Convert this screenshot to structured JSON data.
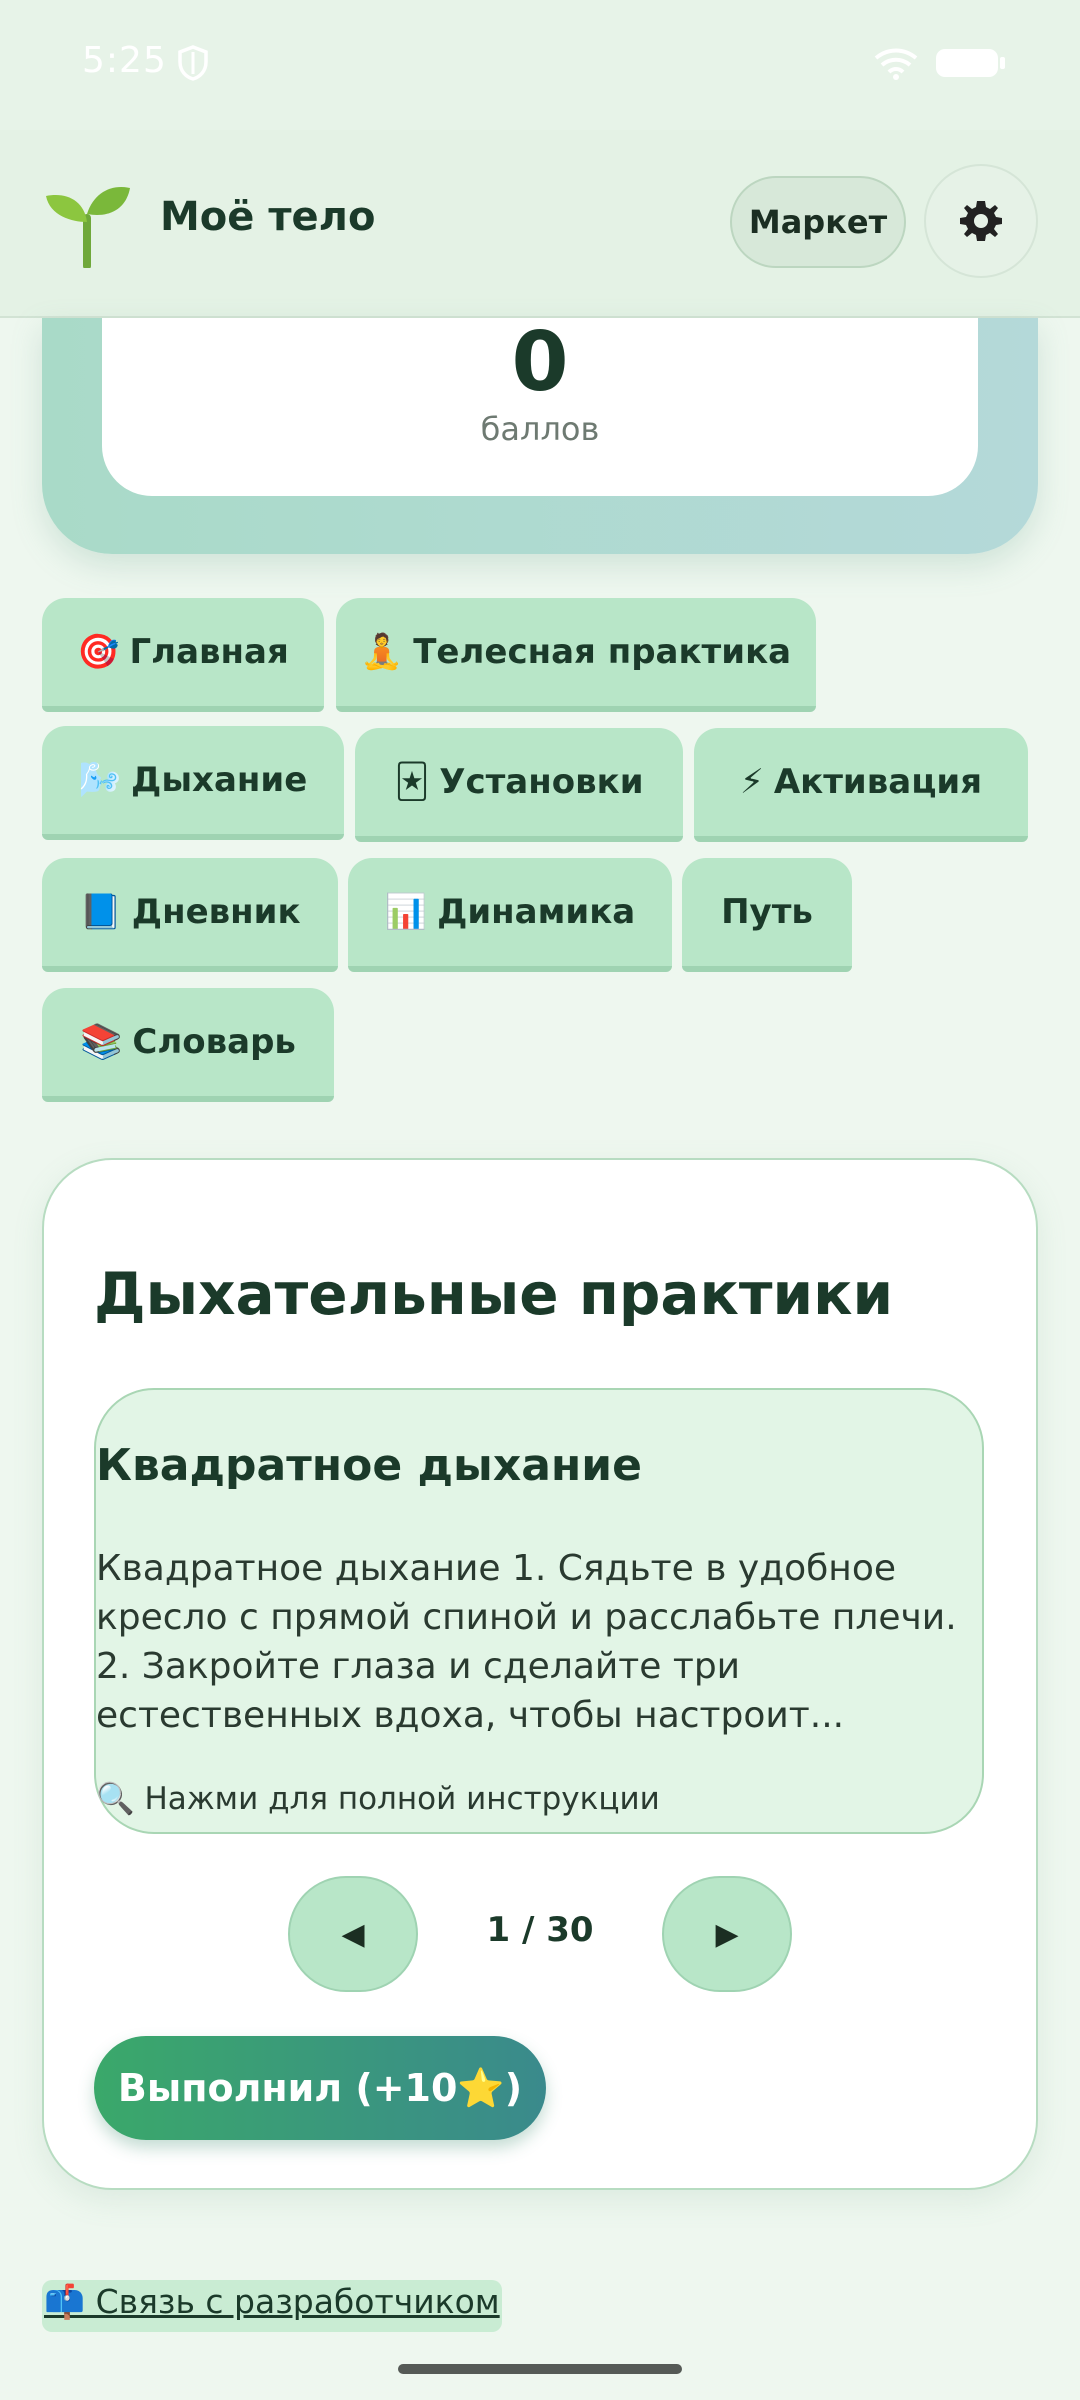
{
  "status_bar": {
    "time": "5:25"
  },
  "header": {
    "title": "Моё тело",
    "market_label": "Маркет",
    "logo_icon": "sprout-icon",
    "settings_icon": "gear-icon"
  },
  "score": {
    "value": "0",
    "label": "баллов"
  },
  "tabs": [
    {
      "emoji": "🎯",
      "label": "Главная"
    },
    {
      "emoji": "🧘",
      "label": "Телесная практика"
    },
    {
      "emoji": "🌬️",
      "label": "Дыхание"
    },
    {
      "emoji": "🃏",
      "label": "Установки"
    },
    {
      "emoji": "⚡",
      "label": "Активация"
    },
    {
      "emoji": "📘",
      "label": "Дневник"
    },
    {
      "emoji": "📊",
      "label": "Динамика"
    },
    {
      "emoji": "",
      "label": "Путь"
    },
    {
      "emoji": "📚",
      "label": "Словарь"
    }
  ],
  "content": {
    "section_title": "Дыхательные практики",
    "practice": {
      "title": "Квадратное дыхание",
      "text": "Квадратное дыхание 1. Сядьте в удобное кресло с прямой спиной и расслабьте плечи. 2. Закройте глаза и сделайте три естественных вдоха, чтобы настроит...",
      "hint": "🔍 Нажми для полной инструкции"
    },
    "pager": {
      "prev": "◀",
      "next": "▶",
      "count": "1 / 30"
    },
    "done_button": "Выполнил (+10⭐)"
  },
  "footer": {
    "contact_link": "📫 Связь с разработчиком"
  },
  "colors": {
    "background": "#eef7ef",
    "tab": "#b8e6c8",
    "accent_start": "#3aa86a",
    "accent_end": "#3a8a8c"
  }
}
